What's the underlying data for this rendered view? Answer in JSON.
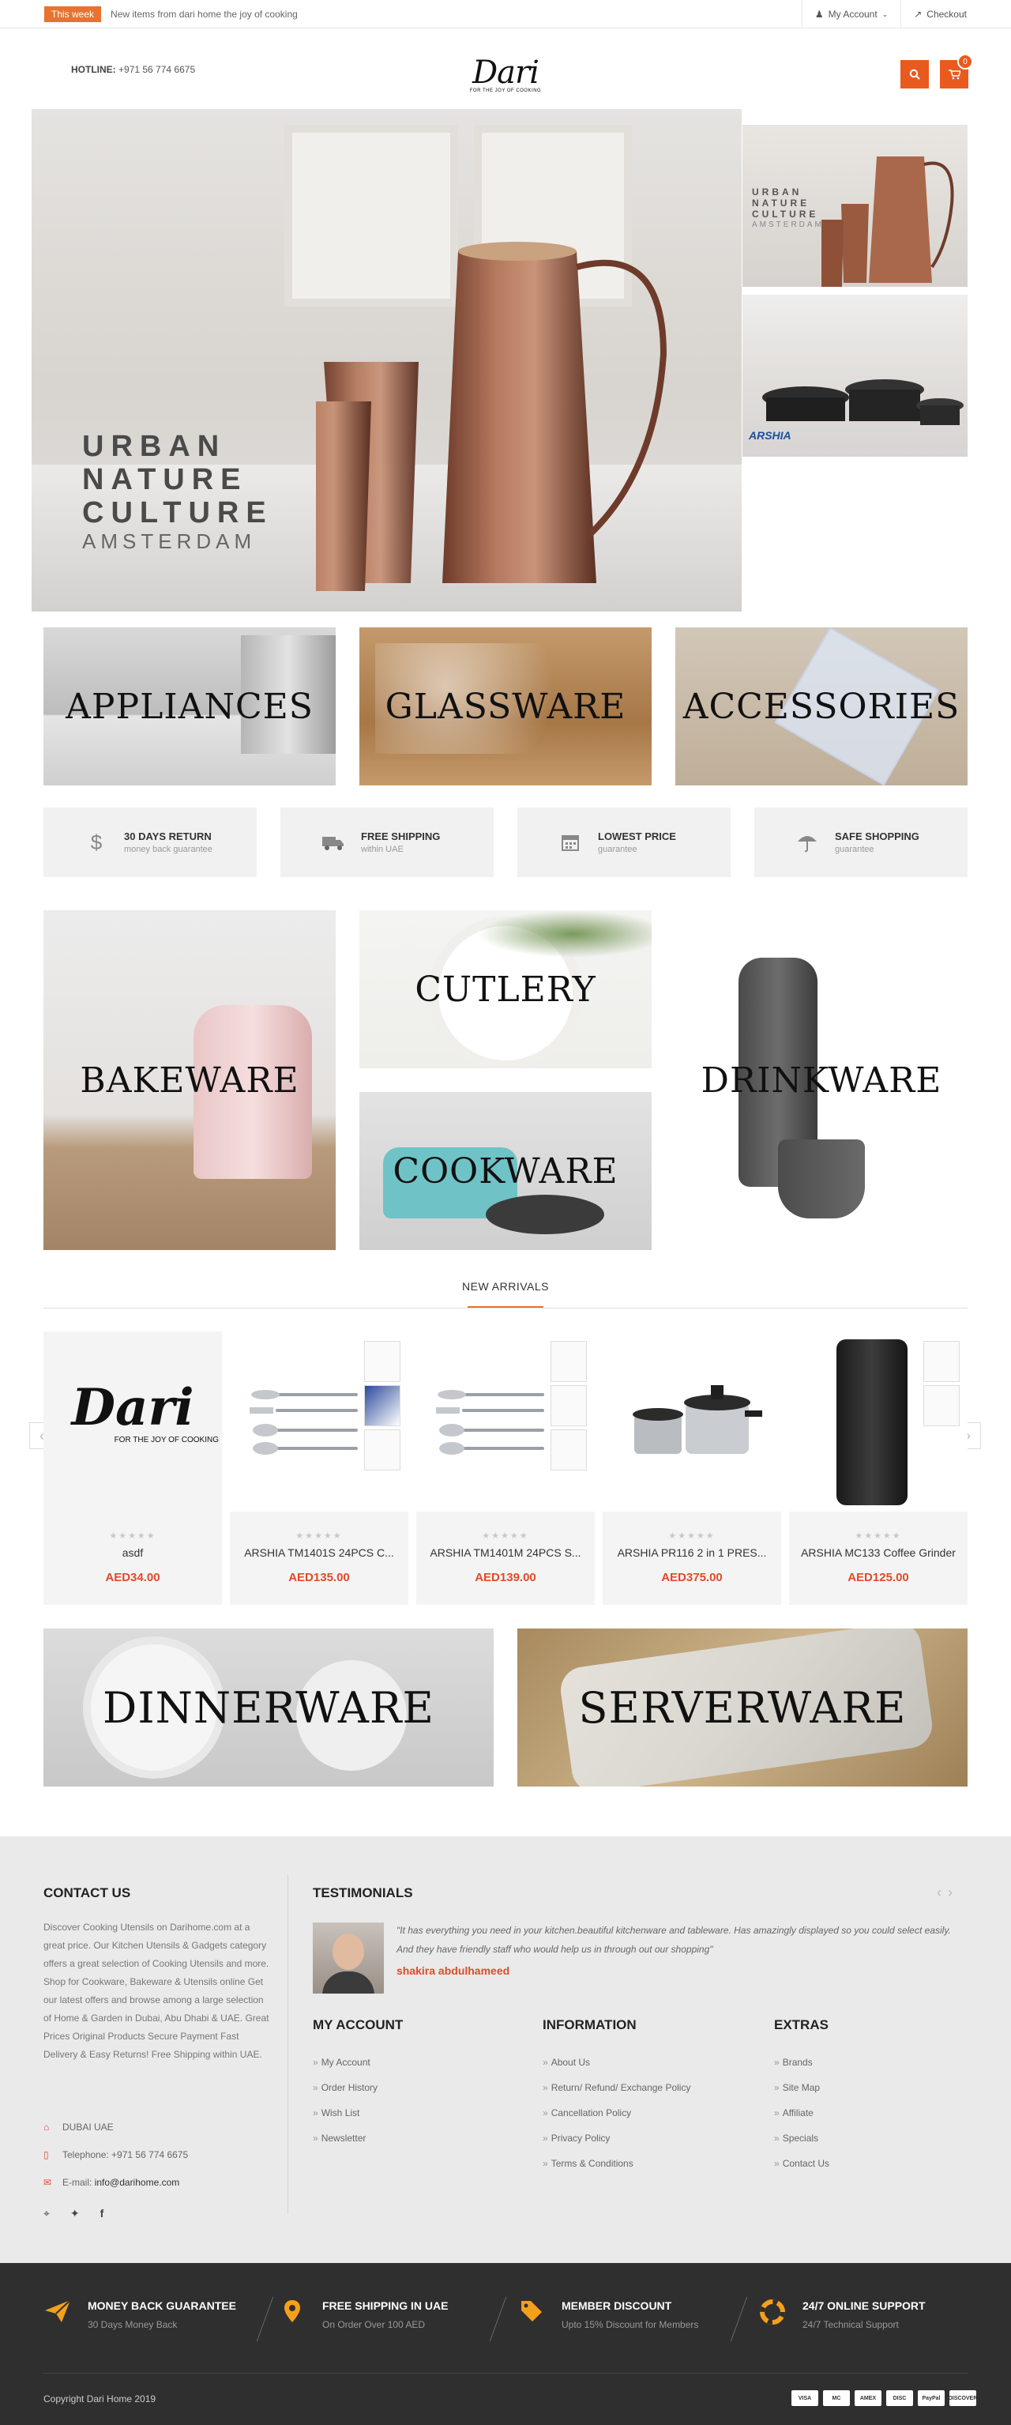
{
  "topbar": {
    "badge": "This week",
    "message": "New items from dari home the joy of cooking",
    "account": "My Account",
    "checkout": "Checkout"
  },
  "header": {
    "hotline_label": "HOTLINE:",
    "hotline_number": "+971 56 774 6675",
    "logo_word": "Dari",
    "logo_tagline": "FOR THE JOY OF COOKING",
    "cart_count": "0"
  },
  "hero": {
    "main_lines": [
      "URBAN",
      "NATURE",
      "CULTURE"
    ],
    "main_sub": "AMSTERDAM",
    "side1_lines": [
      "URBAN",
      "NATURE",
      "CULTURE"
    ],
    "side1_sub": "AMSTERDAM",
    "side2_brand": "ARSHIA"
  },
  "categories_top": [
    "APPLIANCES",
    "GLASSWARE",
    "ACCESSORIES"
  ],
  "features": [
    {
      "title": "30 DAYS RETURN",
      "sub": "money back guarantee",
      "icon": "money-bag-icon"
    },
    {
      "title": "FREE SHIPPING",
      "sub": "within UAE",
      "icon": "truck-icon"
    },
    {
      "title": "LOWEST PRICE",
      "sub": "guarantee",
      "icon": "calendar-icon"
    },
    {
      "title": "SAFE SHOPPING",
      "sub": "guarantee",
      "icon": "umbrella-icon"
    }
  ],
  "categories_mid": {
    "bakeware": "BAKEWARE",
    "cutlery": "CUTLERY",
    "cookware": "COOKWARE",
    "drinkware": "DRINKWARE"
  },
  "arrivals": {
    "title": "NEW ARRIVALS",
    "products": [
      {
        "name": "asdf",
        "price": "AED34.00",
        "rating": "★★★★★"
      },
      {
        "name": "ARSHIA TM1401S 24PCS C...",
        "price": "AED135.00",
        "rating": "★★★★★"
      },
      {
        "name": "ARSHIA TM1401M 24PCS S...",
        "price": "AED139.00",
        "rating": "★★★★★"
      },
      {
        "name": "ARSHIA PR116 2 in 1 PRES...",
        "price": "AED375.00",
        "rating": "★★★★★"
      },
      {
        "name": "ARSHIA MC133 Coffee Grinder",
        "price": "AED125.00",
        "rating": "★★★★★"
      }
    ],
    "product_logo_word": "Dari",
    "product_logo_tag": "FOR THE JOY OF COOKING",
    "prev": "‹",
    "next": "›"
  },
  "categories_bottom": [
    "DINNERWARE",
    "SERVERWARE"
  ],
  "footer": {
    "contact_title": "CONTACT US",
    "contact_text": "Discover Cooking Utensils on Darihome.com at a great price. Our Kitchen Utensils & Gadgets category offers a great selection of Cooking Utensils and more. Shop for Cookware, Bakeware & Utensils online Get our latest offers and browse among a large selection of Home & Garden in Dubai, Abu Dhabi & UAE. Great Prices Original Products Secure Payment Fast Delivery & Easy Returns! Free Shipping within UAE.",
    "address": "DUBAI UAE",
    "telephone": "Telephone: +971 56 774 6675",
    "email_label": "E-mail:",
    "email": "info@darihome.com",
    "testimonials_title": "TESTIMONIALS",
    "testimonial_text": "\"It has everything you need in your kitchen.beautiful kitchenware and tableware. Has amazingly displayed so you could select easily. And they have friendly staff who would help us in through out our shopping\"",
    "testimonial_name": "shakira abdulhameed",
    "account_title": "MY ACCOUNT",
    "account_links": [
      "My Account",
      "Order History",
      "Wish List",
      "Newsletter"
    ],
    "info_title": "INFORMATION",
    "info_links": [
      "About Us",
      "Return/ Refund/ Exchange Policy",
      "Cancellation Policy",
      "Privacy Policy",
      "Terms & Conditions"
    ],
    "extras_title": "EXTRAS",
    "extras_links": [
      "Brands",
      "Site Map",
      "Affiliate",
      "Specials",
      "Contact Us"
    ]
  },
  "bottom": {
    "promos": [
      {
        "title": "MONEY BACK GUARANTEE",
        "sub": "30 Days Money Back",
        "icon": "paper-plane-icon"
      },
      {
        "title": "FREE SHIPPING IN UAE",
        "sub": "On Order Over 100 AED",
        "icon": "map-pin-icon"
      },
      {
        "title": "MEMBER DISCOUNT",
        "sub": "Upto 15% Discount for Members",
        "icon": "tag-icon"
      },
      {
        "title": "24/7 ONLINE SUPPORT",
        "sub": "24/7 Technical Support",
        "icon": "lifebuoy-icon"
      }
    ],
    "copyright": "Copyright Dari Home 2019",
    "payments": [
      "VISA",
      "MC",
      "AMEX",
      "DISC",
      "PayPal",
      "DISCOVER"
    ]
  },
  "colors": {
    "accent": "#e95a1f",
    "price": "#e24a2a",
    "promo_icon": "#f5a01a",
    "footer_bg": "#eaeaea",
    "bottom_bg": "#2f2f2f"
  }
}
